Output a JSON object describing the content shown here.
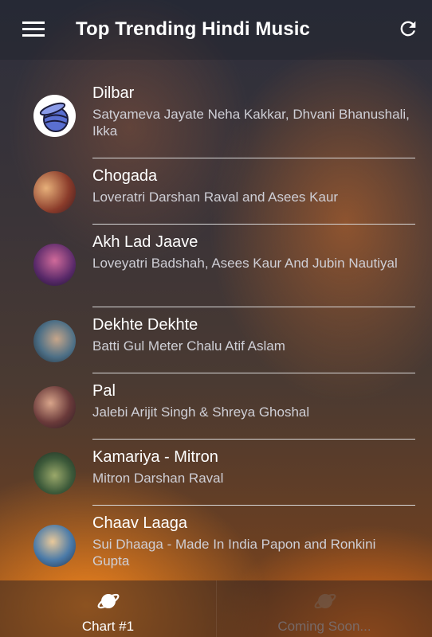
{
  "header": {
    "title": "Top Trending Hindi Music"
  },
  "icons": {
    "menu": "menu-icon",
    "refresh": "refresh-icon",
    "tab": "planet-icon"
  },
  "songs": [
    {
      "title": "Dilbar",
      "subtitle": "Satyameva Jayate Neha Kakkar, Dhvani Bhanushali, Ikka"
    },
    {
      "title": "Chogada",
      "subtitle": "Loveratri Darshan Raval and Asees Kaur"
    },
    {
      "title": "Akh Lad Jaave",
      "subtitle": "Loveyatri Badshah, Asees Kaur And Jubin Nautiyal"
    },
    {
      "title": "Dekhte Dekhte",
      "subtitle": "Batti Gul Meter Chalu Atif Aslam"
    },
    {
      "title": "Pal",
      "subtitle": "Jalebi Arijit Singh & Shreya Ghoshal"
    },
    {
      "title": "Kamariya - Mitron",
      "subtitle": "Mitron Darshan Raval"
    },
    {
      "title": "Chaav Laaga",
      "subtitle": "Sui Dhaaga - Made In India Papon and Ronkini Gupta"
    }
  ],
  "tabs": [
    {
      "label": "Chart #1"
    },
    {
      "label": "Coming Soon..."
    }
  ]
}
